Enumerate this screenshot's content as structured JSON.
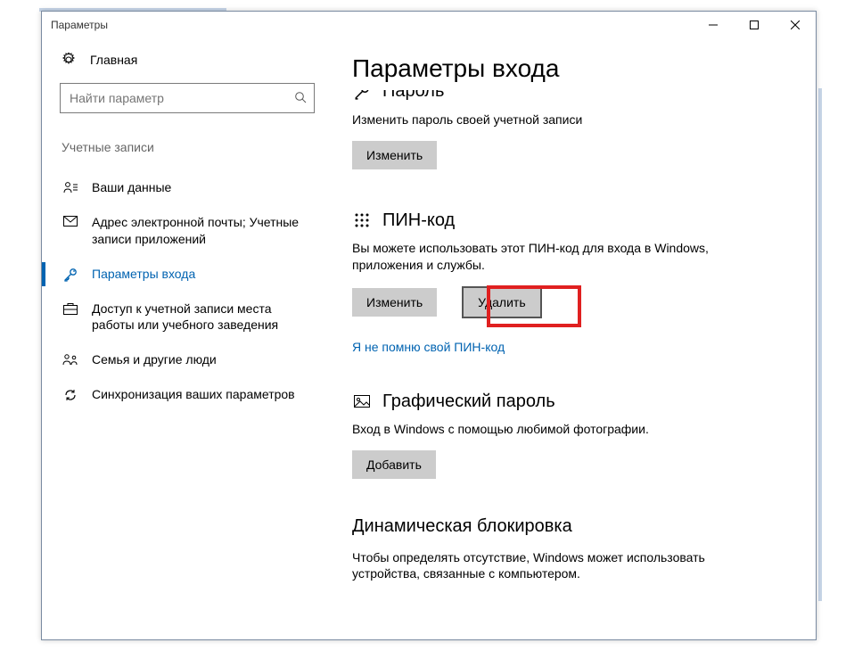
{
  "window": {
    "title": "Параметры"
  },
  "sidebar": {
    "home": "Главная",
    "search_placeholder": "Найти параметр",
    "category": "Учетные записи",
    "items": [
      {
        "label": "Ваши данные"
      },
      {
        "label": "Адрес электронной почты; Учетные записи приложений"
      },
      {
        "label": "Параметры входа"
      },
      {
        "label": "Доступ к учетной записи места работы или учебного заведения"
      },
      {
        "label": "Семья и другие люди"
      },
      {
        "label": "Синхронизация ваших параметров"
      }
    ]
  },
  "main": {
    "title": "Параметры входа",
    "password": {
      "title": "Пароль",
      "desc": "Изменить пароль своей учетной записи",
      "change": "Изменить"
    },
    "pin": {
      "title": "ПИН-код",
      "desc": "Вы можете использовать этот ПИН-код для входа в Windows, приложения и службы.",
      "change": "Изменить",
      "remove": "Удалить",
      "forgot": "Я не помню свой ПИН-код"
    },
    "picture": {
      "title": "Графический пароль",
      "desc": "Вход в Windows с помощью любимой фотографии.",
      "add": "Добавить"
    },
    "dynlock": {
      "title": "Динамическая блокировка",
      "desc": "Чтобы определять отсутствие, Windows может использовать устройства, связанные с компьютером."
    }
  }
}
